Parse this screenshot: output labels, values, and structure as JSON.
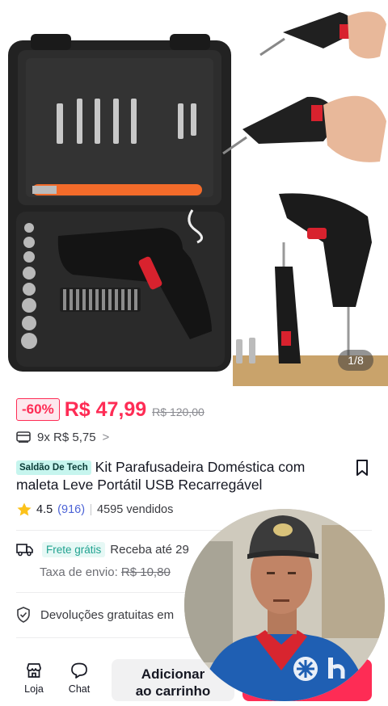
{
  "gallery": {
    "counter": "1/8",
    "images": [
      "screwdriver-kit-case",
      "screwdriver-in-hand-1",
      "screwdriver-in-hand-2",
      "screwdriver-with-bits"
    ]
  },
  "price": {
    "discount": "-60%",
    "current": "R$ 47,99",
    "original": "R$ 120,00"
  },
  "installments": {
    "text": "9x R$ 5,75",
    "chevron": ">"
  },
  "product": {
    "seller_tag": "Saldão De Tech",
    "title": "Kit Parafusadeira Doméstica com maleta Leve Portátil USB Recarregável"
  },
  "rating": {
    "value": "4.5",
    "count": "(916)",
    "sold": "4595 vendidos"
  },
  "shipping": {
    "free_label": "Frete grátis",
    "delivery": "Receba até 29",
    "fee_label": "Taxa de envio: ",
    "fee_old": "R$ 10,80"
  },
  "returns": {
    "text": "Devoluções gratuitas em"
  },
  "bottom_bar": {
    "shop_label": "Loja",
    "chat_label": "Chat",
    "add_cart_line1": "Adicionar",
    "add_cart_line2": "ao carrinho"
  },
  "colors": {
    "accent": "#fe2c55",
    "teal": "#21a290",
    "link": "#4b62d6"
  },
  "icons": [
    "card-icon",
    "chevron-right-icon",
    "bookmark-icon",
    "star-icon",
    "truck-icon",
    "shield-check-icon",
    "shop-icon",
    "chat-icon"
  ]
}
